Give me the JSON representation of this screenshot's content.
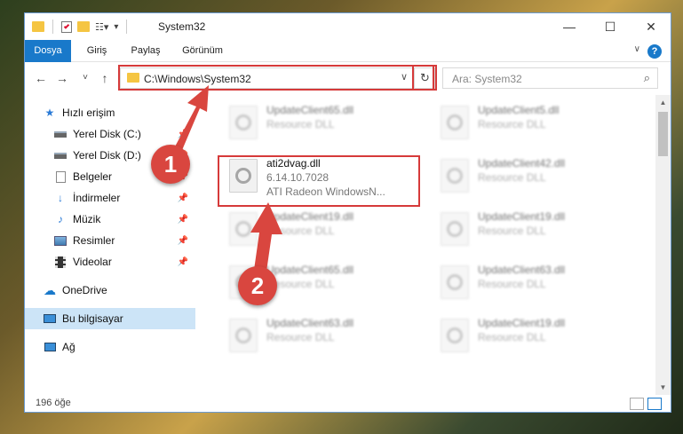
{
  "window": {
    "title": "System32",
    "controls": {
      "minimize": "—",
      "maximize": "☐",
      "close": "✕"
    }
  },
  "ribbon": {
    "tabs": [
      {
        "label": "Dosya",
        "active": true
      },
      {
        "label": "Giriş",
        "active": false
      },
      {
        "label": "Paylaş",
        "active": false
      },
      {
        "label": "Görünüm",
        "active": false
      }
    ],
    "help": "?"
  },
  "nav": {
    "back": "←",
    "forward": "→",
    "recent": "˅",
    "up": "↑",
    "address": "C:\\Windows\\System32",
    "refresh": "↻",
    "search_placeholder": "Ara: System32",
    "search_icon": "⌕"
  },
  "sidebar": {
    "items": [
      {
        "label": "Hızlı erişim",
        "icon": "star-icon",
        "pinned": false,
        "selected": false
      },
      {
        "label": "Yerel Disk (C:)",
        "icon": "drive-icon",
        "pinned": true,
        "selected": false
      },
      {
        "label": "Yerel Disk (D:)",
        "icon": "drive-icon",
        "pinned": true,
        "selected": false
      },
      {
        "label": "Belgeler",
        "icon": "documents-icon",
        "pinned": true,
        "selected": false
      },
      {
        "label": "İndirmeler",
        "icon": "download-icon",
        "pinned": true,
        "selected": false
      },
      {
        "label": "Müzik",
        "icon": "music-icon",
        "pinned": true,
        "selected": false
      },
      {
        "label": "Resimler",
        "icon": "pictures-icon",
        "pinned": true,
        "selected": false
      },
      {
        "label": "Videolar",
        "icon": "video-icon",
        "pinned": true,
        "selected": false
      },
      {
        "label": "OneDrive",
        "icon": "cloud-icon",
        "pinned": false,
        "selected": false
      },
      {
        "label": "Bu bilgisayar",
        "icon": "computer-icon",
        "pinned": false,
        "selected": true
      },
      {
        "label": "Ağ",
        "icon": "network-icon",
        "pinned": false,
        "selected": false
      }
    ]
  },
  "files": {
    "highlighted": {
      "name": "ati2dvag.dll",
      "version": "6.14.10.7028",
      "description": "ATI Radeon WindowsN..."
    },
    "blurred": [
      {
        "name": "UpdateClient65.dll",
        "type": "Resource DLL"
      },
      {
        "name": "UpdateClient5.dll",
        "type": "Resource DLL"
      },
      {
        "name": "UpdateClient42.dll",
        "type": "Resource DLL"
      },
      {
        "name": "UpdateClient19.dll",
        "type": "Resource DLL"
      },
      {
        "name": "UpdateClient19.dll",
        "type": "Resource DLL"
      },
      {
        "name": "UpdateClient65.dll",
        "type": "Resource DLL"
      },
      {
        "name": "UpdateClient63.dll",
        "type": "Resource DLL"
      },
      {
        "name": "UpdateClient63.dll",
        "type": "Resource DLL"
      },
      {
        "name": "UpdateClient19.dll",
        "type": "Resource DLL"
      }
    ]
  },
  "status": {
    "count": "196 öğe"
  },
  "callouts": {
    "one": "1",
    "two": "2"
  },
  "colors": {
    "accent": "#1979ca",
    "highlight": "#d63a3a",
    "callout": "#d9463f",
    "selected": "#cce4f7"
  }
}
